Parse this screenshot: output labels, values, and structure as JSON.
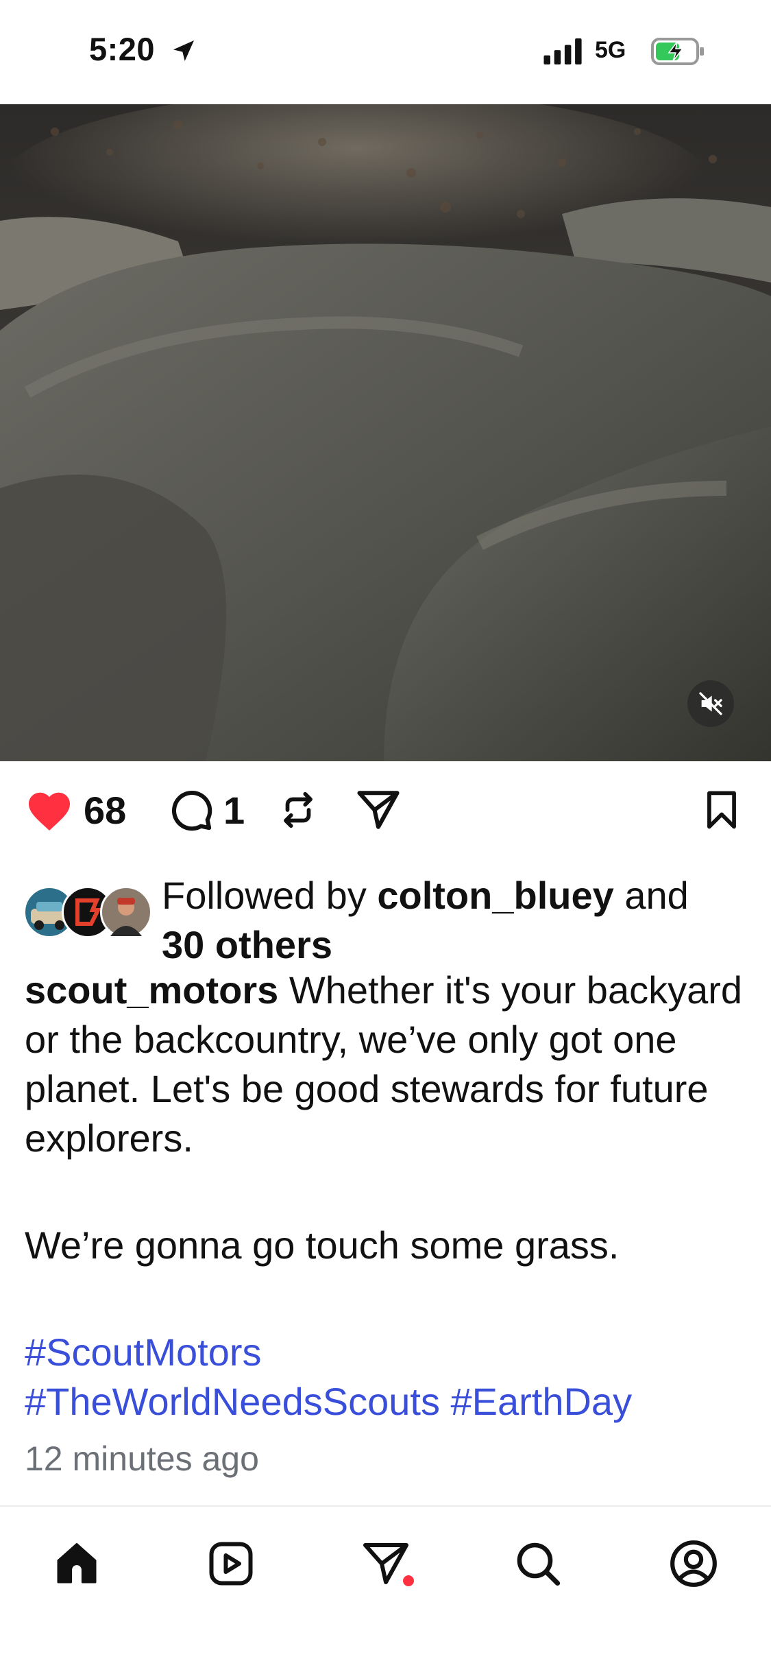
{
  "status_bar": {
    "time": "5:20",
    "network": "5G",
    "location_icon": "location-arrow-icon",
    "signal_icon": "signal-bars-icon",
    "battery_icon": "battery-charging-icon"
  },
  "media": {
    "type": "video",
    "subject": "rocks on a forest trail",
    "mute_icon": "speaker-muted-icon"
  },
  "actions": {
    "likes": "68",
    "comments": "1",
    "like_icon": "heart-filled-icon",
    "comment_icon": "comment-bubble-icon",
    "repost_icon": "repost-icon",
    "share_icon": "send-icon",
    "save_icon": "bookmark-icon",
    "like_color": "#ff3040"
  },
  "followed_by": {
    "prefix": "Followed by ",
    "user": "colton_bluey",
    "middle": " and",
    "others": "30 others"
  },
  "caption": {
    "username": "scout_motors",
    "text": " Whether it's your backyard or the backcountry, we’ve only got one planet. Let's be good stewards for future explorers.",
    "line2": "We’re gonna go touch some grass.",
    "hashtags": [
      "#ScoutMotors",
      "#TheWorldNeedsScouts",
      "#EarthDay"
    ],
    "hashtag_color": "#3a4fd9"
  },
  "timestamp": "12 minutes ago",
  "tabbar": {
    "items": [
      "home-icon",
      "reels-icon",
      "send-icon",
      "search-icon",
      "profile-icon"
    ],
    "notification_dot_color": "#ff3040"
  }
}
